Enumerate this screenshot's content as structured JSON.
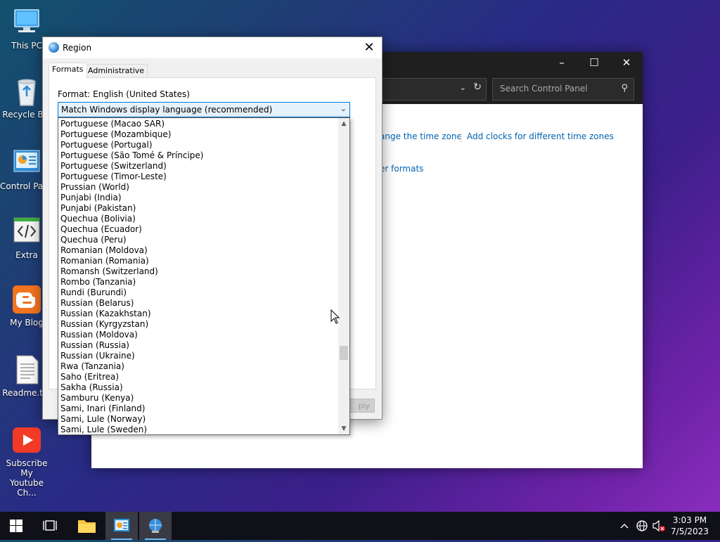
{
  "desktop": {
    "icons": [
      {
        "label": "This PC"
      },
      {
        "label": "Recycle Bin"
      },
      {
        "label": "Control Panel"
      },
      {
        "label": "Extra"
      },
      {
        "label": "My Blog"
      },
      {
        "label": "Readme.txt"
      },
      {
        "label": "Subscribe My\nYoutube Ch..."
      }
    ]
  },
  "control_panel": {
    "search_placeholder": "Search Control Panel",
    "link_change_timezone": "ange the time zone",
    "link_add_clocks": "Add clocks for different time zones",
    "link_other_formats": "er formats"
  },
  "region_dialog": {
    "title": "Region",
    "tabs": [
      "Formats",
      "Administrative"
    ],
    "format_label": "Format: English (United States)",
    "combo_value": "Match Windows display language (recommended)",
    "apply_label": "ply",
    "dropdown_items": [
      "Portuguese (Macao SAR)",
      "Portuguese (Mozambique)",
      "Portuguese (Portugal)",
      "Portuguese (São Tomé & Príncipe)",
      "Portuguese (Switzerland)",
      "Portuguese (Timor-Leste)",
      "Prussian (World)",
      "Punjabi (India)",
      "Punjabi (Pakistan)",
      "Quechua (Bolivia)",
      "Quechua (Ecuador)",
      "Quechua (Peru)",
      "Romanian (Moldova)",
      "Romanian (Romania)",
      "Romansh (Switzerland)",
      "Rombo (Tanzania)",
      "Rundi (Burundi)",
      "Russian (Belarus)",
      "Russian (Kazakhstan)",
      "Russian (Kyrgyzstan)",
      "Russian (Moldova)",
      "Russian (Russia)",
      "Russian (Ukraine)",
      "Rwa (Tanzania)",
      "Saho (Eritrea)",
      "Sakha (Russia)",
      "Samburu (Kenya)",
      "Sami, Inari (Finland)",
      "Sami, Lule (Norway)",
      "Sami, Lule (Sweden)"
    ]
  },
  "taskbar": {
    "time": "3:03 PM",
    "date": "7/5/2023"
  },
  "colors": {
    "accent": "#0078d7",
    "link": "#0063b1",
    "taskbar": "#101018"
  }
}
